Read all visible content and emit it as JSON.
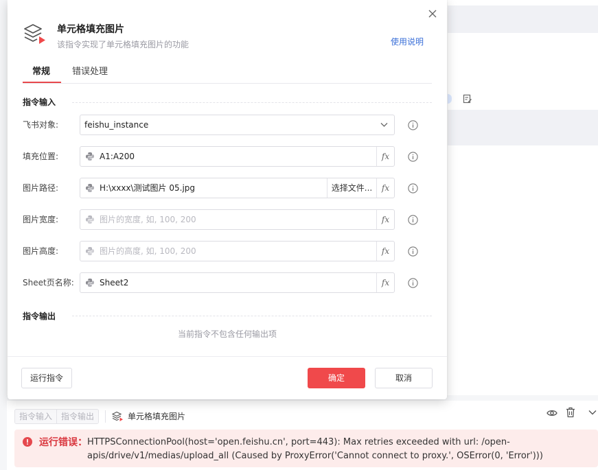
{
  "dialog": {
    "title": "单元格填充图片",
    "subtitle": "该指令实现了单元格填充图片的功能",
    "help_link": "使用说明",
    "tabs": [
      {
        "label": "常规",
        "active": true
      },
      {
        "label": "错误处理",
        "active": false
      }
    ],
    "input_section_title": "指令输入",
    "output_section_title": "指令输出",
    "output_empty_text": "当前指令不包含任何输出项",
    "fields": [
      {
        "label": "飞书对象:",
        "value": "feishu_instance",
        "type": "select"
      },
      {
        "label": "填充位置:",
        "value": "A1:A200",
        "type": "python"
      },
      {
        "label": "图片路径:",
        "value": "H:\\xxxx\\测试图片 05.jpg",
        "type": "python",
        "choose_file_label": "选择文件..."
      },
      {
        "label": "图片宽度:",
        "placeholder": "图片的宽度, 如, 100, 200",
        "type": "python"
      },
      {
        "label": "图片高度:",
        "placeholder": "图片的高度, 如, 100, 200",
        "type": "python"
      },
      {
        "label": "Sheet页名称:",
        "value": "Sheet2",
        "type": "python"
      }
    ],
    "fx_label": "fx",
    "buttons": {
      "run": "运行指令",
      "ok": "确定",
      "cancel": "取消"
    }
  },
  "bottom_panel": {
    "tabs": [
      "指令输入",
      "指令输出"
    ],
    "command_title": "单元格填充图片",
    "error_label": "运行错误：",
    "error_message": "HTTPSConnectionPool(host='open.feishu.cn', port=443): Max retries exceeded with url: /open-apis/drive/v1/medias/upload_all (Caused by ProxyError('Cannot connect to proxy.', OSError(0, 'Error')))"
  },
  "colors": {
    "primary_red": "#f0494b",
    "link_blue": "#3a6fd8",
    "error_bg": "#fdeceb",
    "error_red": "#d9363e"
  }
}
